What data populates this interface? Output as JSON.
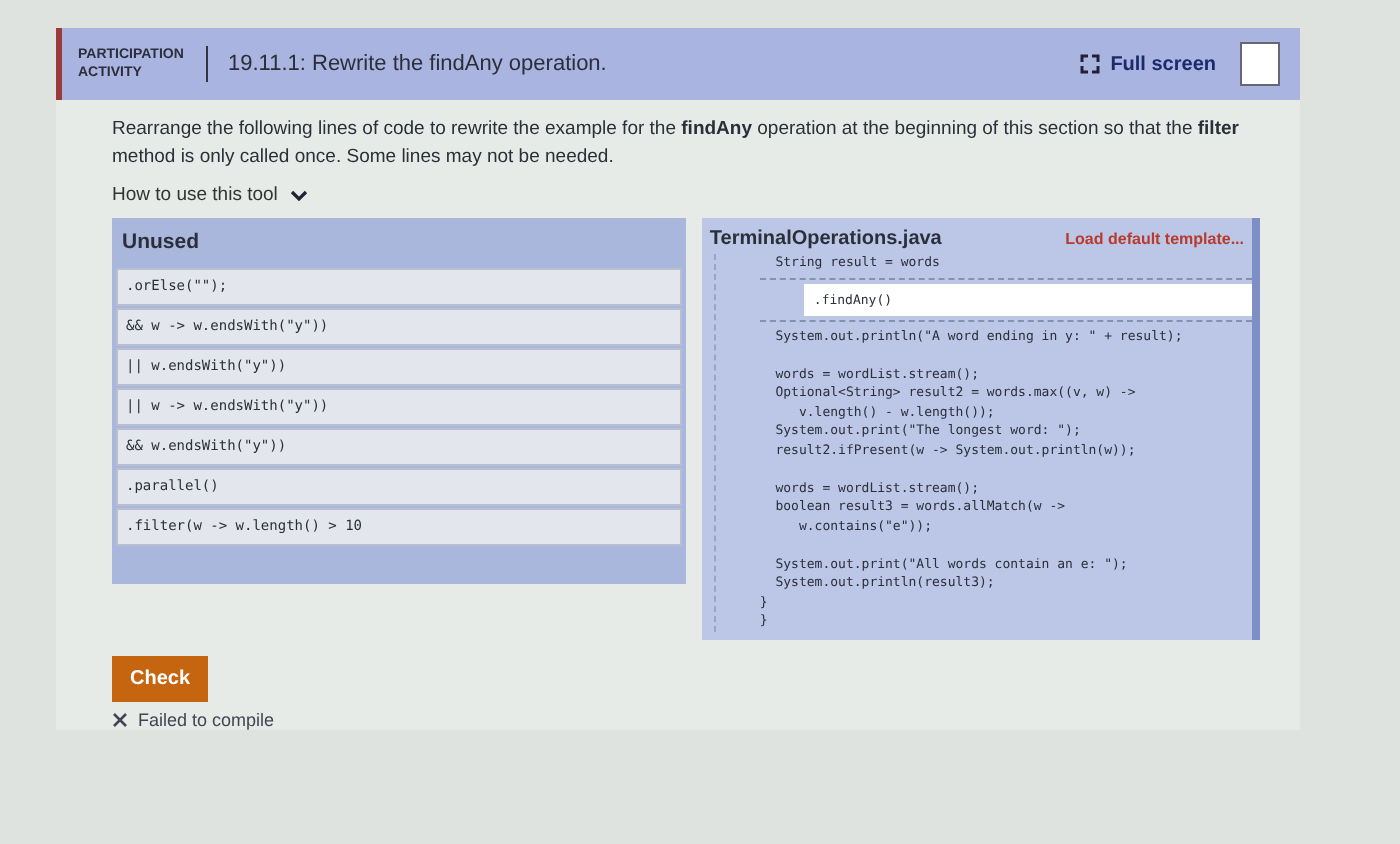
{
  "activity": {
    "badge": "PARTICIPATION ACTIVITY",
    "title": "19.11.1: Rewrite the findAny operation.",
    "fullscreen": "Full screen"
  },
  "instructions": "Rearrange the following lines of code to rewrite the example for the **findAny** operation at the beginning of this section so that the **filter** method is only called once. Some lines may not be needed.",
  "help_toggle": "How to use this tool",
  "unused": {
    "title": "Unused",
    "items": [
      ".orElse(\"\");",
      "&& w -> w.endsWith(\"y\"))",
      "|| w.endsWith(\"y\"))",
      "|| w -> w.endsWith(\"y\"))",
      "&& w.endsWith(\"y\"))",
      ".parallel()",
      ".filter(w -> w.length() > 10"
    ]
  },
  "editor": {
    "filename": "TerminalOperations.java",
    "load_default": "Load default template...",
    "lines": [
      {
        "kind": "code",
        "text": "  String result = words"
      },
      {
        "kind": "slot",
        "text": ".findAny()"
      },
      {
        "kind": "code",
        "text": "  System.out.println(\"A word ending in y: \" + result);"
      },
      {
        "kind": "blank"
      },
      {
        "kind": "code",
        "text": "  words = wordList.stream();"
      },
      {
        "kind": "code",
        "text": "  Optional<String> result2 = words.max((v, w) ->"
      },
      {
        "kind": "code",
        "text": "     v.length() - w.length());"
      },
      {
        "kind": "code",
        "text": "  System.out.print(\"The longest word: \");"
      },
      {
        "kind": "code",
        "text": "  result2.ifPresent(w -> System.out.println(w));"
      },
      {
        "kind": "blank"
      },
      {
        "kind": "code",
        "text": "  words = wordList.stream();"
      },
      {
        "kind": "code",
        "text": "  boolean result3 = words.allMatch(w ->"
      },
      {
        "kind": "code",
        "text": "     w.contains(\"e\"));"
      },
      {
        "kind": "blank"
      },
      {
        "kind": "code",
        "text": "  System.out.print(\"All words contain an e: \");"
      },
      {
        "kind": "code",
        "text": "  System.out.println(result3);"
      },
      {
        "kind": "code",
        "text": "}"
      },
      {
        "kind": "code",
        "text": "}"
      }
    ]
  },
  "check_button": "Check",
  "result": "Failed to compile"
}
